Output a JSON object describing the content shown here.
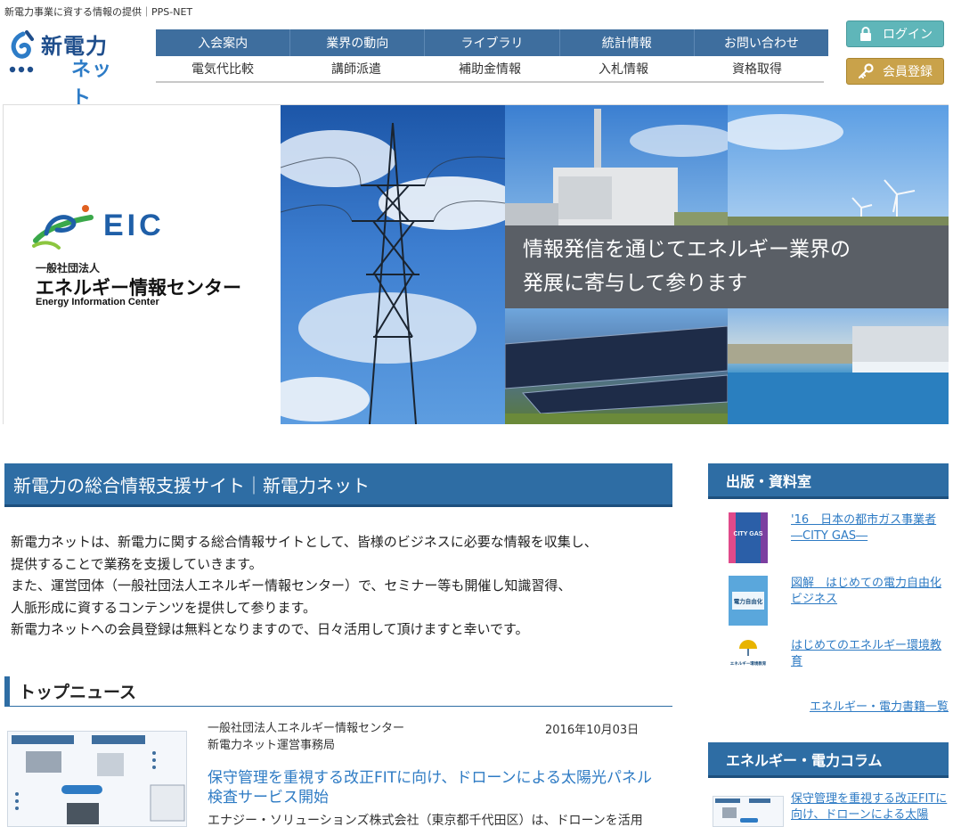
{
  "header": {
    "tagline": "新電力事業に資する情報の提供｜PPS-NET",
    "logo_line1": "新電力",
    "logo_line2": "ネット"
  },
  "nav": {
    "primary": [
      "入会案内",
      "業界の動向",
      "ライブラリ",
      "統計情報",
      "お問い合わせ"
    ],
    "secondary": [
      "電気代比較",
      "講師派遣",
      "補助金情報",
      "入札情報",
      "資格取得"
    ]
  },
  "buttons": {
    "login": "ログイン",
    "register": "会員登録"
  },
  "hero": {
    "eic_logo_text": "EIC",
    "corp_type": "一般社団法人",
    "org_name": "エネルギー情報センター",
    "org_name_en": "Energy Information Center",
    "slogan_line1": "情報発信を通じてエネルギー業界の",
    "slogan_line2": "発展に寄与して参ります"
  },
  "intro": {
    "heading": "新電力の総合情報支援サイト｜新電力ネット",
    "lines": [
      "新電力ネットは、新電力に関する総合情報サイトとして、皆様のビジネスに必要な情報を収集し、",
      "提供することで業務を支援していきます。",
      "また、運営団体（一般社団法人エネルギー情報センター）で、セミナー等も開催し知識習得、",
      "人脈形成に資するコンテンツを提供して参ります。",
      "新電力ネットへの会員登録は無料となりますので、日々活用して頂けますと幸いです。"
    ]
  },
  "news": {
    "heading": "トップニュース",
    "org_line1": "一般社団法人エネルギー情報センター",
    "org_line2": "新電力ネット運営事務局",
    "date": "2016年10月03日",
    "title": "保守管理を重視する改正FITに向け、ドローンによる太陽光パネル検査サービス開始",
    "body": "エナジー・ソリューションズ株式会社（東京都千代田区）は、ドローンを活用"
  },
  "sidebar": {
    "publications_heading": "出版・資料室",
    "books": [
      {
        "title": "'16　日本の都市ガス事業者―CITY GAS―",
        "cover_text": "CITY GAS"
      },
      {
        "title": "図解　はじめての電力自由化ビジネス",
        "cover_text": "電力自由化"
      },
      {
        "title": "はじめてのエネルギー環境教育",
        "cover_text": "エネルギー環境教育"
      }
    ],
    "more_link": "エネルギー・電力書籍一覧",
    "column_heading": "エネルギー・電力コラム",
    "column_link": "保守管理を重視する改正FITに向け、ドローンによる太陽"
  },
  "colors": {
    "nav_blue": "#3e6e9e",
    "heading_blue": "#2e6da4",
    "link_blue": "#2e7bc4",
    "login_teal": "#5fb6b9",
    "register_gold": "#c9a24a"
  }
}
